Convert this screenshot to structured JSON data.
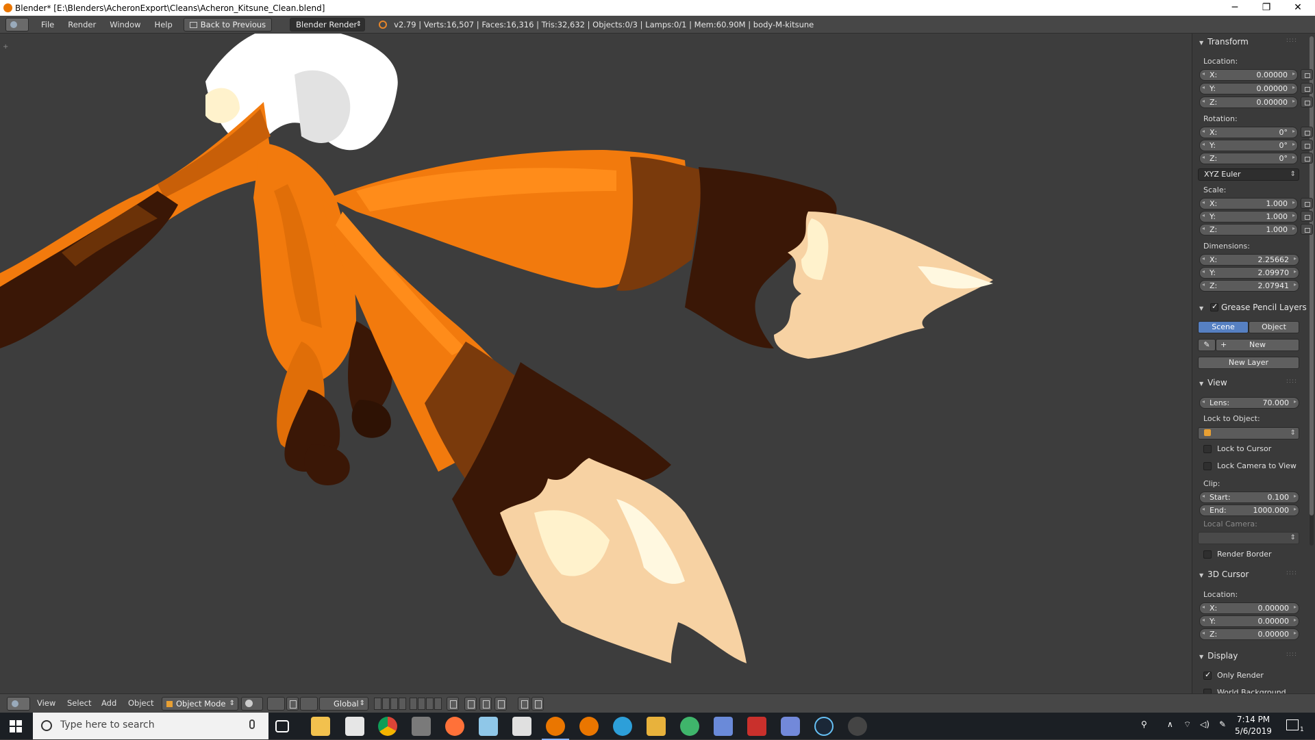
{
  "window": {
    "title": "Blender* [E:\\Blenders\\AcheronExport\\Cleans\\Acheron_Kitsune_Clean.blend]",
    "minimize": "─",
    "restore": "❐",
    "close": "✕"
  },
  "info_header": {
    "menus": [
      "File",
      "Render",
      "Window",
      "Help"
    ],
    "back_button": "Back to Previous",
    "render_engine": "Blender Render",
    "stats": "v2.79 | Verts:16,507 | Faces:16,316 | Tris:32,632 | Objects:0/3 | Lamps:0/1 | Mem:60.90M | body-M-kitsune"
  },
  "properties_panel": {
    "transform": {
      "title": "Transform",
      "location_label": "Location:",
      "location": [
        {
          "axis": "X:",
          "value": "0.00000"
        },
        {
          "axis": "Y:",
          "value": "0.00000"
        },
        {
          "axis": "Z:",
          "value": "0.00000"
        }
      ],
      "rotation_label": "Rotation:",
      "rotation": [
        {
          "axis": "X:",
          "value": "0°"
        },
        {
          "axis": "Y:",
          "value": "0°"
        },
        {
          "axis": "Z:",
          "value": "0°"
        }
      ],
      "rotation_mode": "XYZ Euler",
      "scale_label": "Scale:",
      "scale": [
        {
          "axis": "X:",
          "value": "1.000"
        },
        {
          "axis": "Y:",
          "value": "1.000"
        },
        {
          "axis": "Z:",
          "value": "1.000"
        }
      ],
      "dimensions_label": "Dimensions:",
      "dimensions": [
        {
          "axis": "X:",
          "value": "2.25662"
        },
        {
          "axis": "Y:",
          "value": "2.09970"
        },
        {
          "axis": "Z:",
          "value": "2.07941"
        }
      ]
    },
    "grease_pencil": {
      "title": "Grease Pencil Layers",
      "tab_scene": "Scene",
      "tab_object": "Object",
      "new": "New",
      "new_layer": "New Layer"
    },
    "view": {
      "title": "View",
      "lens_label": "Lens:",
      "lens_value": "70.000",
      "lock_to_object": "Lock to Object:",
      "lock_to_cursor": "Lock to Cursor",
      "lock_camera_to_view": "Lock Camera to View",
      "clip_label": "Clip:",
      "clip_start_label": "Start:",
      "clip_start": "0.100",
      "clip_end_label": "End:",
      "clip_end": "1000.000",
      "local_camera": "Local Camera:",
      "render_border": "Render Border"
    },
    "cursor": {
      "title": "3D Cursor",
      "location_label": "Location:",
      "location": [
        {
          "axis": "X:",
          "value": "0.00000"
        },
        {
          "axis": "Y:",
          "value": "0.00000"
        },
        {
          "axis": "Z:",
          "value": "0.00000"
        }
      ]
    },
    "display": {
      "title": "Display",
      "only_render": "Only Render",
      "world_background": "World Background"
    }
  },
  "viewport_header": {
    "menus": [
      "View",
      "Select",
      "Add",
      "Object"
    ],
    "mode": "Object Mode",
    "orientation": "Global"
  },
  "taskbar": {
    "search_placeholder": "Type here to search",
    "time": "7:14 PM",
    "date": "5/6/2019",
    "notification_count": "1"
  },
  "colors": {
    "fur_orange": "#f27a0d",
    "fur_dark": "#3a1706",
    "fur_mid": "#7a3a0c",
    "tip_cream": "#f7d2a3",
    "tip_light": "#fff2cc",
    "accent_blue": "#5680c2"
  }
}
